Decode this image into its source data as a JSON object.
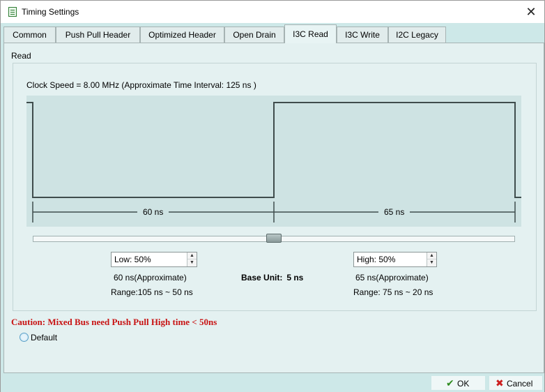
{
  "window": {
    "title": "Timing Settings",
    "close_glyph": "✕"
  },
  "tabs": [
    {
      "label": "Common",
      "active": false
    },
    {
      "label": "Push Pull Header",
      "active": false
    },
    {
      "label": "Optimized Header",
      "active": false
    },
    {
      "label": "Open Drain",
      "active": false
    },
    {
      "label": "I3C Read",
      "active": true
    },
    {
      "label": "I3C Write",
      "active": false
    },
    {
      "label": "I2C Legacy",
      "active": false
    }
  ],
  "panel": {
    "section_label": "Read",
    "clock_text": "Clock Speed = 8.00 MHz  (Approximate Time Interval: 125 ns )",
    "diagram": {
      "low_label": "60 ns",
      "high_label": "65 ns"
    },
    "slider": {
      "value_percent": 50
    },
    "low": {
      "value": "Low: 50%",
      "approx": "60 ns(Approximate)",
      "range": "Range:105 ns ~  50 ns"
    },
    "high": {
      "value": "High: 50%",
      "approx": "65 ns(Approximate)",
      "range": "Range: 75 ns ~  20 ns"
    },
    "base_unit": {
      "label": "Base Unit:",
      "value": "5 ns"
    }
  },
  "caution": "Caution: Mixed Bus need Push Pull High time < 50ns",
  "default_option": {
    "label": "Default",
    "checked": false
  },
  "buttons": {
    "ok": {
      "label": "OK",
      "icon": "check-icon",
      "color": "#2e8b1f"
    },
    "cancel": {
      "label": "Cancel",
      "icon": "x-icon",
      "color": "#cc1f1f"
    }
  },
  "colors": {
    "background": "#cde8e8",
    "diagram_bg": "#cee3e3",
    "caution": "#c81414"
  }
}
